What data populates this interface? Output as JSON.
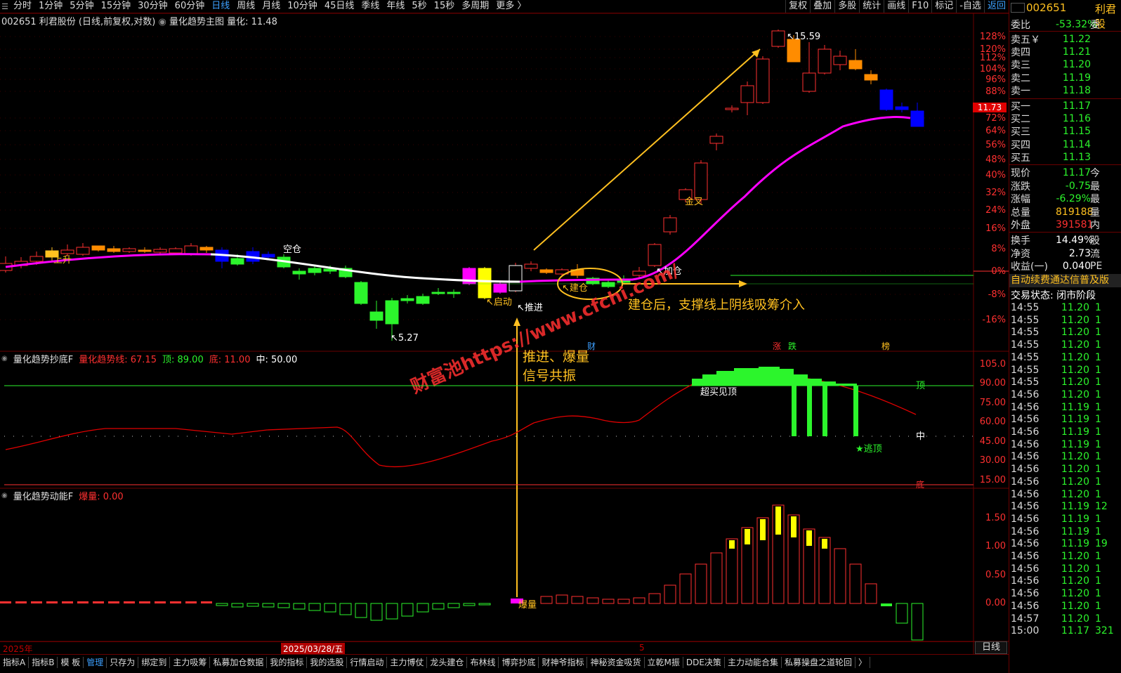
{
  "toolbar": {
    "periods": [
      "分时",
      "1分钟",
      "5分钟",
      "15分钟",
      "30分钟",
      "60分钟",
      "日线",
      "周线",
      "月线",
      "10分钟",
      "45日线",
      "季线",
      "年线",
      "5秒",
      "15秒",
      "多周期",
      "更多 〉"
    ],
    "active": "日线",
    "tools": [
      "复权",
      "叠加",
      "多股",
      "统计",
      "画线",
      "F10",
      "标记",
      "-自选",
      "返回"
    ]
  },
  "header": {
    "stock": "002651 利君股份 (日线,前复权,对数)",
    "indicator": "量化趋势主图",
    "value_label": "量化:",
    "value": "11.48"
  },
  "main_axis": [
    "128%",
    "120%",
    "112%",
    "104%",
    "96%",
    "88%",
    "72%",
    "64%",
    "56%",
    "48%",
    "40%",
    "32%",
    "24%",
    "16%",
    "8%",
    "0%",
    "-8%",
    "-16%"
  ],
  "current_price_tag": "11.73",
  "annotations": {
    "high": "15.59",
    "low": "5.27",
    "up": "上升",
    "empty": "空仓",
    "start": "启动",
    "push": "推进",
    "build": "建仓",
    "add": "加仓",
    "gold": "金叉",
    "boom": "爆量",
    "overbought": "超买见顶",
    "escape": "★逃顶",
    "top": "顶",
    "mid": "中",
    "bottom": "底",
    "resonance1": "推进、爆量",
    "resonance2": "信号共振",
    "after_build": "建仓后，支撑线上阴线吸筹介入",
    "watermark": "财富池https://www.cfchi.com/",
    "marks": [
      "财",
      "涨",
      "跌",
      "榜"
    ]
  },
  "panel2": {
    "name": "量化趋势抄底F",
    "line_label": "量化趋势线:",
    "line_val": "67.15",
    "top_label": "顶:",
    "top_val": "89.00",
    "bot_label": "底:",
    "bot_val": "11.00",
    "mid_label": "中:",
    "mid_val": "50.00",
    "axis": [
      "105.0",
      "90.00",
      "75.00",
      "60.00",
      "45.00",
      "30.00",
      "15.00"
    ]
  },
  "panel3": {
    "name": "量化趋势动能F",
    "label": "爆量:",
    "val": "0.00",
    "axis": [
      "1.50",
      "1.00",
      "0.50",
      "0.00"
    ]
  },
  "dates": {
    "year": "2025年",
    "cursor": "2025/03/28/五",
    "month": "5"
  },
  "bottom_tabs": [
    "指标A",
    "指标B",
    "模 板",
    "管理",
    "只存为",
    "绑定到",
    "主力吸筹",
    "私募加仓数据",
    "我的指标",
    "我的选股",
    "行情启动",
    "主力博仗",
    "龙头建仓",
    "布林线",
    "博弈抄底",
    "财神爷指标",
    "神秘资金吸货",
    "立乾M振",
    "DDE决策",
    "主力动能合集",
    "私募操盘之道轮回",
    "〉"
  ],
  "bottom_active": "管理",
  "side_button": "日线",
  "quote": {
    "code": "002651",
    "name": "利君股",
    "wei_bi": {
      "label": "委比",
      "val": "-53.32%",
      "tail": "委"
    },
    "asks": [
      {
        "label": "卖五￥",
        "price": "11.22"
      },
      {
        "label": "卖四",
        "price": "11.21"
      },
      {
        "label": "卖三",
        "price": "11.20"
      },
      {
        "label": "卖二",
        "price": "11.19"
      },
      {
        "label": "卖一",
        "price": "11.18"
      }
    ],
    "bids": [
      {
        "label": "买一",
        "price": "11.17"
      },
      {
        "label": "买二",
        "price": "11.16"
      },
      {
        "label": "买三",
        "price": "11.15"
      },
      {
        "label": "买四",
        "price": "11.14"
      },
      {
        "label": "买五",
        "price": "11.13"
      }
    ],
    "stats": [
      {
        "label": "现价",
        "val": "11.17",
        "tail": "今",
        "c": "g"
      },
      {
        "label": "涨跌",
        "val": "-0.75",
        "tail": "最",
        "c": "g"
      },
      {
        "label": "涨幅",
        "val": "-6.29%",
        "tail": "最",
        "c": "g"
      },
      {
        "label": "总量",
        "val": "819188",
        "tail": "量",
        "c": "y"
      },
      {
        "label": "外盘",
        "val": "391581",
        "tail": "内",
        "c": "r"
      }
    ],
    "stats2": [
      {
        "label": "换手",
        "val": "14.49%",
        "tail": "股",
        "c": "w"
      },
      {
        "label": "净资",
        "val": "2.73",
        "tail": "流",
        "c": "w"
      },
      {
        "label": "收益(一)",
        "val": "0.040",
        "tail": "PE",
        "c": "w"
      }
    ],
    "notice": "自动续费通达信普及版",
    "state": "交易状态: 闭市阶段",
    "ticks": [
      [
        "14:55",
        "11.20",
        "1"
      ],
      [
        "14:55",
        "11.20",
        "1"
      ],
      [
        "14:55",
        "11.20",
        "1"
      ],
      [
        "14:55",
        "11.20",
        "1"
      ],
      [
        "14:55",
        "11.20",
        "1"
      ],
      [
        "14:55",
        "11.20",
        "1"
      ],
      [
        "14:55",
        "11.20",
        "1"
      ],
      [
        "14:56",
        "11.20",
        "1"
      ],
      [
        "14:56",
        "11.19",
        "1"
      ],
      [
        "14:56",
        "11.19",
        "1"
      ],
      [
        "14:56",
        "11.19",
        "1"
      ],
      [
        "14:56",
        "11.19",
        "1"
      ],
      [
        "14:56",
        "11.20",
        "1"
      ],
      [
        "14:56",
        "11.20",
        "1"
      ],
      [
        "14:56",
        "11.20",
        "1"
      ],
      [
        "14:56",
        "11.20",
        "1"
      ],
      [
        "14:56",
        "11.19",
        "12"
      ],
      [
        "14:56",
        "11.19",
        "1"
      ],
      [
        "14:56",
        "11.19",
        "1"
      ],
      [
        "14:56",
        "11.19",
        "19"
      ],
      [
        "14:56",
        "11.20",
        "1"
      ],
      [
        "14:56",
        "11.20",
        "1"
      ],
      [
        "14:56",
        "11.20",
        "1"
      ],
      [
        "14:56",
        "11.20",
        "1"
      ],
      [
        "14:56",
        "11.20",
        "1"
      ],
      [
        "14:57",
        "11.20",
        "1"
      ],
      [
        "15:00",
        "11.17",
        "321"
      ]
    ]
  }
}
